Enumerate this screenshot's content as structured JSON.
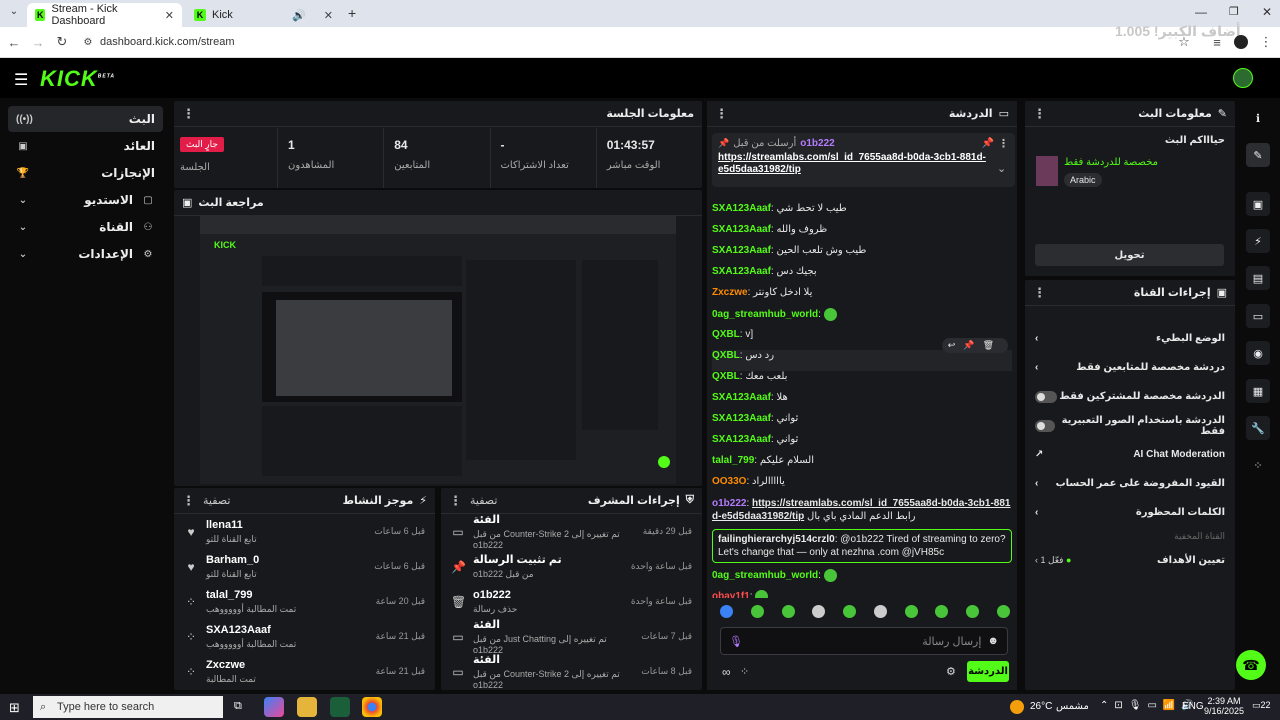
{
  "browser": {
    "tabs": [
      {
        "title": "Stream - Kick Dashboard",
        "active": true
      },
      {
        "title": "Kick",
        "active": false
      }
    ],
    "url": "dashboard.kick.com/stream",
    "overlay_text": "أضاف الكبير! 1.005"
  },
  "header": {
    "logo": "KICK",
    "beta": "BETA"
  },
  "sidebar": {
    "items": [
      {
        "label": "البث",
        "icon": "broadcast-icon"
      },
      {
        "label": "العائد",
        "icon": "dollar-icon"
      },
      {
        "label": "الإنجازات",
        "icon": "trophy-icon"
      },
      {
        "label": "الاستديو",
        "icon": "studio-icon"
      },
      {
        "label": "القناة",
        "icon": "channel-icon"
      },
      {
        "label": "الإعدادات",
        "icon": "settings-icon"
      }
    ]
  },
  "session": {
    "title": "معلومات الجلسة",
    "live_badge": "جارٍ البث",
    "live_label": "الجلسة",
    "stats": [
      {
        "value": "01:43:57",
        "label": "الوقت مباشر"
      },
      {
        "value": "-",
        "label": "تعداد الاشتراكات"
      },
      {
        "value": "84",
        "label": "المتابعين"
      },
      {
        "value": "1",
        "label": "المشاهدون"
      }
    ]
  },
  "preview": {
    "title": "مراجعة البث"
  },
  "activity": {
    "title": "موجز النشاط",
    "filter": "تصفية",
    "items": [
      {
        "name": "llena11",
        "sub": "تابع القناة للتو",
        "time": "قبل 6 ساعات",
        "icon": "heart-icon"
      },
      {
        "name": "Barham_0",
        "sub": "تابع القناة للتو",
        "time": "قبل 6 ساعات",
        "icon": "heart-icon"
      },
      {
        "name": "talal_799",
        "sub": "تمت المطالبة أوووووهب",
        "time": "قبل 20 ساعة",
        "icon": "points-icon"
      },
      {
        "name": "SXA123Aaaf",
        "sub": "تمت المطالبة أوووووهب",
        "time": "قبل 21 ساعة",
        "icon": "points-icon"
      },
      {
        "name": "Zxczwe",
        "sub": "تمت المطالبة",
        "time": "قبل 21 ساعة",
        "icon": "points-icon"
      }
    ]
  },
  "modactions": {
    "title": "إجراءات المشرف",
    "filter": "تصفية",
    "items": [
      {
        "name": "الفئة",
        "sub": "تم تغييره إلى Counter-Strike 2 من قبل o1b222",
        "time": "قبل 29 دقيقة",
        "icon": "category-icon"
      },
      {
        "name": "تم تثبيت الرسالة",
        "sub": "من قبل o1b222",
        "time": "قبل ساعة واحدة",
        "icon": "pin-icon"
      },
      {
        "name": "o1b222",
        "sub": "حذف رسالة",
        "time": "قبل ساعة واحدة",
        "icon": "trash-icon"
      },
      {
        "name": "الفئة",
        "sub": "تم تغييره إلى Just Chatting من قبل o1b222",
        "time": "قبل 7 ساعات",
        "icon": "category-icon"
      },
      {
        "name": "الفئة",
        "sub": "تم تغييره إلى Counter-Strike 2 من قبل o1b222",
        "time": "قبل 8 ساعات",
        "icon": "category-icon"
      }
    ]
  },
  "chat": {
    "title": "الدردشة",
    "pinned_by": "أرسلت من قبل",
    "pinned_user": "o1b222",
    "pinned_link": "https://streamlabs.com/sl_id_7655aa8d-b0da-3cb1-881d-e5d5daa31982/tip",
    "pinned_caption": "رابط الدعم المادي باي بال",
    "messages": [
      {
        "user": "SXA123Aaaf",
        "color": "g",
        "text": "طيب لا تحط شي"
      },
      {
        "user": "SXA123Aaaf",
        "color": "g",
        "text": "ظروف والله"
      },
      {
        "user": "SXA123Aaaf",
        "color": "g",
        "text": "طيب وش تلعب الحين"
      },
      {
        "user": "SXA123Aaaf",
        "color": "g",
        "text": "بجيك دس"
      },
      {
        "user": "Zxczwe",
        "color": "o",
        "text": "يلا ادخل كاونتر"
      },
      {
        "user": "0ag_streamhub_world",
        "color": "g",
        "text": "",
        "emote": true
      },
      {
        "user": "QXBL",
        "color": "g",
        "text": "v]"
      },
      {
        "user": "QXBL",
        "color": "g",
        "text": "رد دس"
      },
      {
        "user": "QXBL",
        "color": "g",
        "text": "بلعب معك"
      },
      {
        "user": "SXA123Aaaf",
        "color": "g",
        "text": "هلا"
      },
      {
        "user": "SXA123Aaaf",
        "color": "g",
        "text": "ثواني"
      },
      {
        "user": "SXA123Aaaf",
        "color": "g",
        "text": "ثواني"
      },
      {
        "user": "talal_799",
        "color": "g",
        "text": "السلام عليكم"
      },
      {
        "user": "OO33O",
        "color": "o",
        "text": "يااااالراد"
      }
    ],
    "link_user": "o1b222",
    "link_text": "https://streamlabs.com/sl_id_7655aa8d-b0da-3cb1-881d-e5d5daa31982/tip",
    "link_caption": "رابط الدعم المادي باي بال",
    "highlight_user": "failinghierarchyj514crzl0",
    "highlight_text": "@o1b222 Tired of streaming to zero? Let's change that — only at nezhna .com @jVH85c",
    "after": [
      {
        "user": "0ag_streamhub_world",
        "color": "g",
        "text": "",
        "emote": true
      },
      {
        "user": "obay1f1",
        "color": "r",
        "text": "",
        "emote": true
      }
    ],
    "input_placeholder": "إرسال رسالة",
    "send_label": "الدردشة"
  },
  "stream_info": {
    "title": "معلومات البث",
    "stream_title": "حياااكم البث",
    "category": "مخصصة للدردشة فقط",
    "language": "Arabic",
    "edit_label": "تحويل"
  },
  "channel_actions": {
    "title": "إجراءات القناة",
    "rows": [
      {
        "label": "الوضع البطيء",
        "control": "chevron"
      },
      {
        "label": "دردشة مخصصة للمتابعين فقط",
        "control": "chevron"
      },
      {
        "label": "الدردشة مخصصة للمشتركين فقط",
        "control": "toggle"
      },
      {
        "label": "الدردشة باستخدام الصور التعبيرية فقط",
        "control": "toggle"
      },
      {
        "label": "AI Chat Moderation",
        "control": "external"
      },
      {
        "label": "القيود المفروضة على عمر الحساب",
        "control": "chevron"
      },
      {
        "label": "الكلمات المحظورة",
        "control": "chevron"
      }
    ],
    "hidden_label": "القناة المخفية",
    "goals_label": "تعيين الأهداف",
    "goals_value": "فعّل 1"
  },
  "taskbar": {
    "search_placeholder": "Type here to search",
    "weather": "26°C",
    "weather_desc": "مشمس",
    "lang": "ENG",
    "time": "2:39 AM",
    "date": "9/16/2025",
    "notif": "22"
  }
}
